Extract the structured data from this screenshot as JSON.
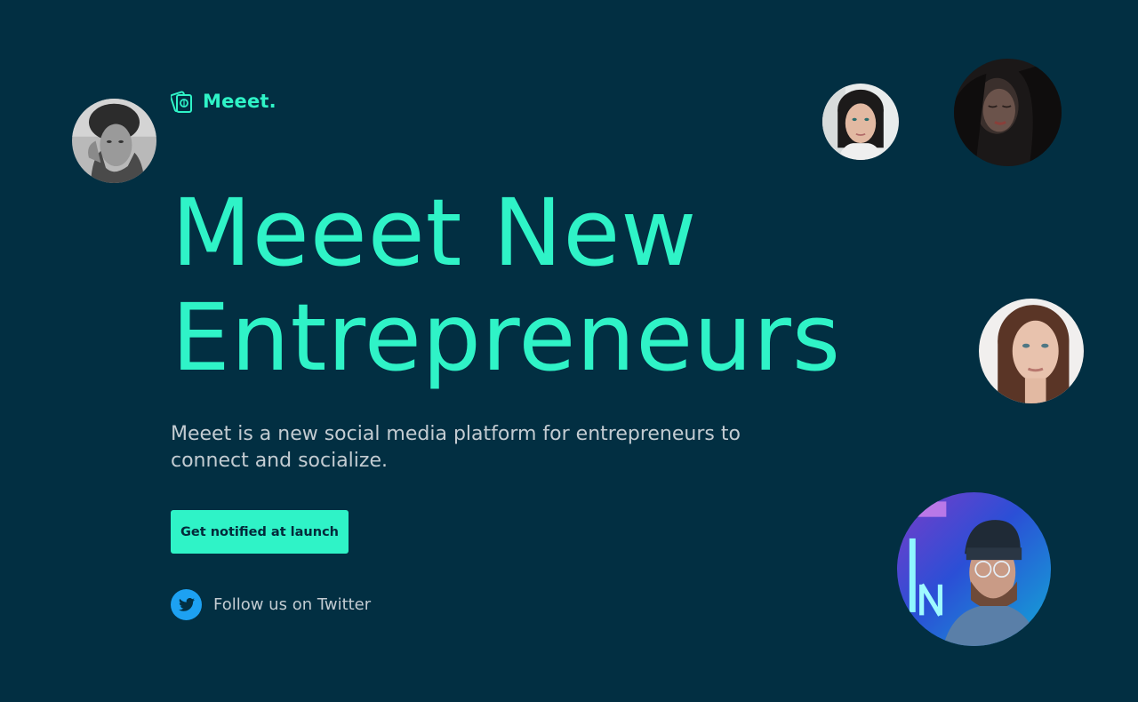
{
  "brand": {
    "name": "Meeet.",
    "logo_icon": "passport-cards-icon",
    "accent_color": "#2ff3c7",
    "background_color": "#022f42"
  },
  "hero": {
    "headline_line1": "Meeet New",
    "headline_line2": "Entrepreneurs",
    "description": "Meeet is a new social media platform for entrepreneurs to connect and socialize."
  },
  "cta": {
    "label": "Get notified at launch"
  },
  "social": {
    "twitter_label": "Follow us on Twitter",
    "twitter_icon": "twitter-bird-icon",
    "twitter_color": "#1da1f2"
  },
  "avatars": [
    {
      "name": "avatar-man-curly-hair"
    },
    {
      "name": "avatar-woman-dark-hair"
    },
    {
      "name": "avatar-woman-eyes-closed"
    },
    {
      "name": "avatar-woman-auburn-hair"
    },
    {
      "name": "avatar-man-beanie-neon"
    }
  ]
}
